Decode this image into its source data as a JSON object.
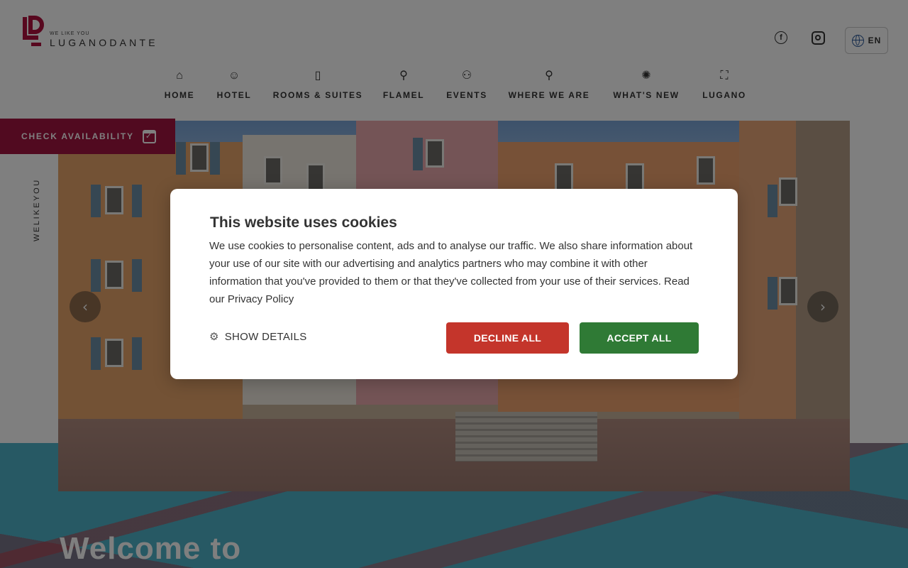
{
  "header": {
    "logo_tagline": "WE LIKE YOU",
    "logo_name": "LUGANODANTE",
    "language": "EN"
  },
  "nav": {
    "items": [
      {
        "label": "HOME",
        "icon": "building-icon"
      },
      {
        "label": "HOTEL",
        "icon": "smile-icon"
      },
      {
        "label": "ROOMS & SUITES",
        "icon": "door-icon"
      },
      {
        "label": "FLAMEL",
        "icon": "cutlery-icon"
      },
      {
        "label": "EVENTS",
        "icon": "people-icon"
      },
      {
        "label": "WHERE WE ARE",
        "icon": "map-pin-icon"
      },
      {
        "label": "WHAT'S NEW",
        "icon": "sparkle-icon"
      },
      {
        "label": "LUGANO",
        "icon": "scan-icon"
      }
    ]
  },
  "booking": {
    "check_availability": "CHECK AVAILABILITY"
  },
  "side_text": "WELIKEYOU",
  "hero": {
    "welcome": "Welcome to"
  },
  "cookie_dialog": {
    "title": "This website uses cookies",
    "body": "We use cookies to personalise content, ads and to analyse our traffic. We also share information about your use of our site with our advertising and analytics partners who may combine it with other information that you've provided to them or that they've collected from your use of their services. Read our Privacy Policy",
    "show_details": "SHOW DETAILS",
    "decline": "DECLINE ALL",
    "accept": "ACCEPT ALL"
  },
  "colors": {
    "brand": "#a31440",
    "decline": "#c4352b",
    "accept": "#2f7a35"
  }
}
